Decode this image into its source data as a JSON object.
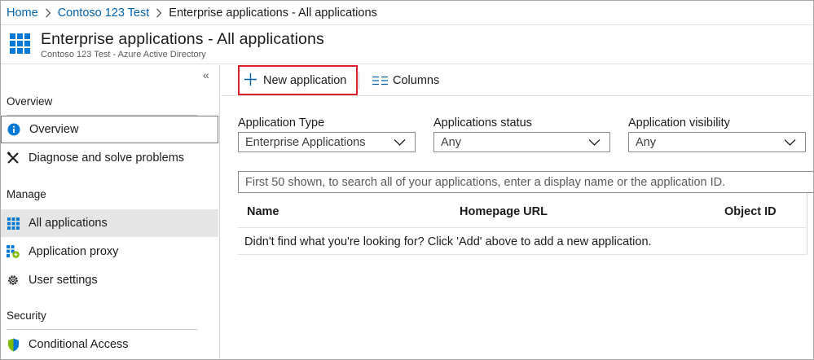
{
  "breadcrumb": {
    "home": "Home",
    "tenant": "Contoso 123 Test",
    "current": "Enterprise applications - All applications"
  },
  "header": {
    "title": "Enterprise applications - All applications",
    "subtitle": "Contoso 123 Test - Azure Active Directory",
    "icon": "enterprise-apps-grid-icon"
  },
  "sidebar": {
    "collapse_label": "«",
    "sections": {
      "overview": "Overview",
      "manage": "Manage",
      "security": "Security"
    },
    "items": {
      "overview": "Overview",
      "diagnose": "Diagnose and solve problems",
      "all_applications": "All applications",
      "application_proxy": "Application proxy",
      "user_settings": "User settings",
      "conditional_access": "Conditional Access"
    }
  },
  "toolbar": {
    "new_application": "New application",
    "columns": "Columns"
  },
  "filters": {
    "application_type": {
      "label": "Application Type",
      "value": "Enterprise Applications"
    },
    "applications_status": {
      "label": "Applications status",
      "value": "Any"
    },
    "application_visibility": {
      "label": "Application visibility",
      "value": "Any"
    }
  },
  "search": {
    "placeholder": "First 50 shown, to search all of your applications, enter a display name or the application ID."
  },
  "table": {
    "columns": [
      "Name",
      "Homepage URL",
      "Object ID"
    ],
    "empty_message": "Didn't find what you're looking for? Click 'Add' above to add a new application."
  },
  "colors": {
    "link": "#0062ad",
    "highlight_border": "#d9202c",
    "selected_bg": "#e6e6e6",
    "azure_blue": "#0078d4"
  }
}
